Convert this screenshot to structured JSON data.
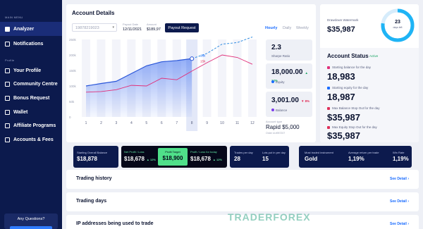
{
  "sidebar": {
    "main_menu_label": "MAIN MENU",
    "profile_label": "Profile",
    "items": [
      {
        "label": "Analyzer",
        "icon": "grid-icon",
        "active": true
      },
      {
        "label": "Notifications",
        "icon": "bell-icon"
      },
      {
        "label": "Your Profile",
        "icon": "user-icon"
      },
      {
        "label": "Community Centre",
        "icon": "people-icon"
      },
      {
        "label": "Bonus Request",
        "icon": "gift-icon"
      },
      {
        "label": "Wallet",
        "icon": "wallet-icon"
      },
      {
        "label": "Affiliate Programs",
        "icon": "share-icon"
      },
      {
        "label": "Accounts & Fees",
        "icon": "coins-icon"
      }
    ],
    "questions": "Any Questions?"
  },
  "details": {
    "title": "Account Details",
    "account_id": "19878219023",
    "payout_date_label": "Payout Date",
    "payout_date": "12/11/2021",
    "amount_label": "Amount",
    "amount": "$189,97",
    "payout_button": "Payout Request",
    "tabs": [
      "Hourly",
      "Daily",
      "Weekly"
    ],
    "sharpe_value": "2.3",
    "sharpe_label": "Sharpe Ratio",
    "equity_value": "18,000.00",
    "equity_delta": "▲ 12%",
    "equity_label": "Equity",
    "balance_value": "3,001.00",
    "balance_delta": "▼ 8%",
    "balance_label": "Balance",
    "account_type_label": "Account type",
    "account_type": "Rapid $5,000",
    "order_id": "Order id #957207",
    "colors": {
      "equity": "#1a6cff",
      "balance": "#e0305a"
    }
  },
  "chart_data": {
    "type": "line",
    "x": [
      1,
      2,
      3,
      4,
      5,
      6,
      7,
      8,
      9,
      10,
      11,
      12
    ],
    "y_ticks": [
      "250k",
      "200k",
      "150k",
      "100k",
      "50k",
      "0"
    ],
    "ylim": [
      0,
      250000
    ],
    "series": [
      {
        "name": "Equity",
        "values": [
          100000,
          108000,
          115000,
          140000,
          165000,
          178000,
          182000,
          188000
        ]
      },
      {
        "name": "Balance",
        "values": [
          80000,
          82000,
          88000,
          102000,
          100000,
          125000,
          120000,
          148000
        ]
      },
      {
        "name": "",
        "values": [
          null,
          null,
          null,
          null,
          null,
          null,
          null,
          188000,
          205000,
          235000,
          240000,
          258000
        ],
        "dashed": true
      },
      {
        "name": "",
        "values": [
          null,
          null,
          null,
          null,
          null,
          null,
          null,
          148000,
          175000,
          200000,
          192000,
          170000
        ]
      }
    ],
    "markers": {
      "equity_label": "18k",
      "balance_label": "15k"
    },
    "highlight_x": 8
  },
  "stats": {
    "drawdown_label": "Drawdown Watermark",
    "drawdown_value": "$35,987",
    "gauge_value": "23",
    "gauge_unit": "days left",
    "gauge_fraction": 0.77,
    "title": "Account Status",
    "status": "Active",
    "rows": [
      {
        "label": "Starting balance for the day",
        "value": "18,983",
        "color": "#e0307a"
      },
      {
        "label": "Starting equity for the day",
        "value": "18,987",
        "color": "#1a6cff"
      },
      {
        "label": "Max Balance Stop Out for the day",
        "value": "$35,987",
        "color": "#e0305a"
      },
      {
        "label": "Max Equity Stop Out for the day",
        "value": "$35,987",
        "color": "#e0305a"
      }
    ]
  },
  "kpis": {
    "starting_balance_label": "Starting Overall Balance",
    "starting_balance": "$18,878",
    "net_profit_label": "Net Profit / Loss",
    "net_profit": "$18,678",
    "net_profit_delta": "▲ 12%",
    "profit_target_label": "Profit Target",
    "profit_target": "$18,900",
    "today_label": "Profit / Loss for today",
    "today": "$18,678",
    "today_delta": "▲ 12%",
    "trades_label": "Trades per day",
    "trades": "28",
    "lots_label": "Lots put in per day",
    "lots": "15",
    "instrument_label": "Most traded instrument",
    "instrument": "Gold",
    "avg_return_label": "Average return per trade",
    "avg_return": "1,19%",
    "win_rate_label": "Win Rate",
    "win_rate": "1,19%"
  },
  "sections": [
    {
      "title": "Trading history",
      "link": "See Detail  ›"
    },
    {
      "title": "Trading days",
      "link": "See Detail  ›"
    },
    {
      "title": "IP addresses being used to trade",
      "link": "See Detail  ›"
    }
  ],
  "watermark": "TRADERFOREX"
}
